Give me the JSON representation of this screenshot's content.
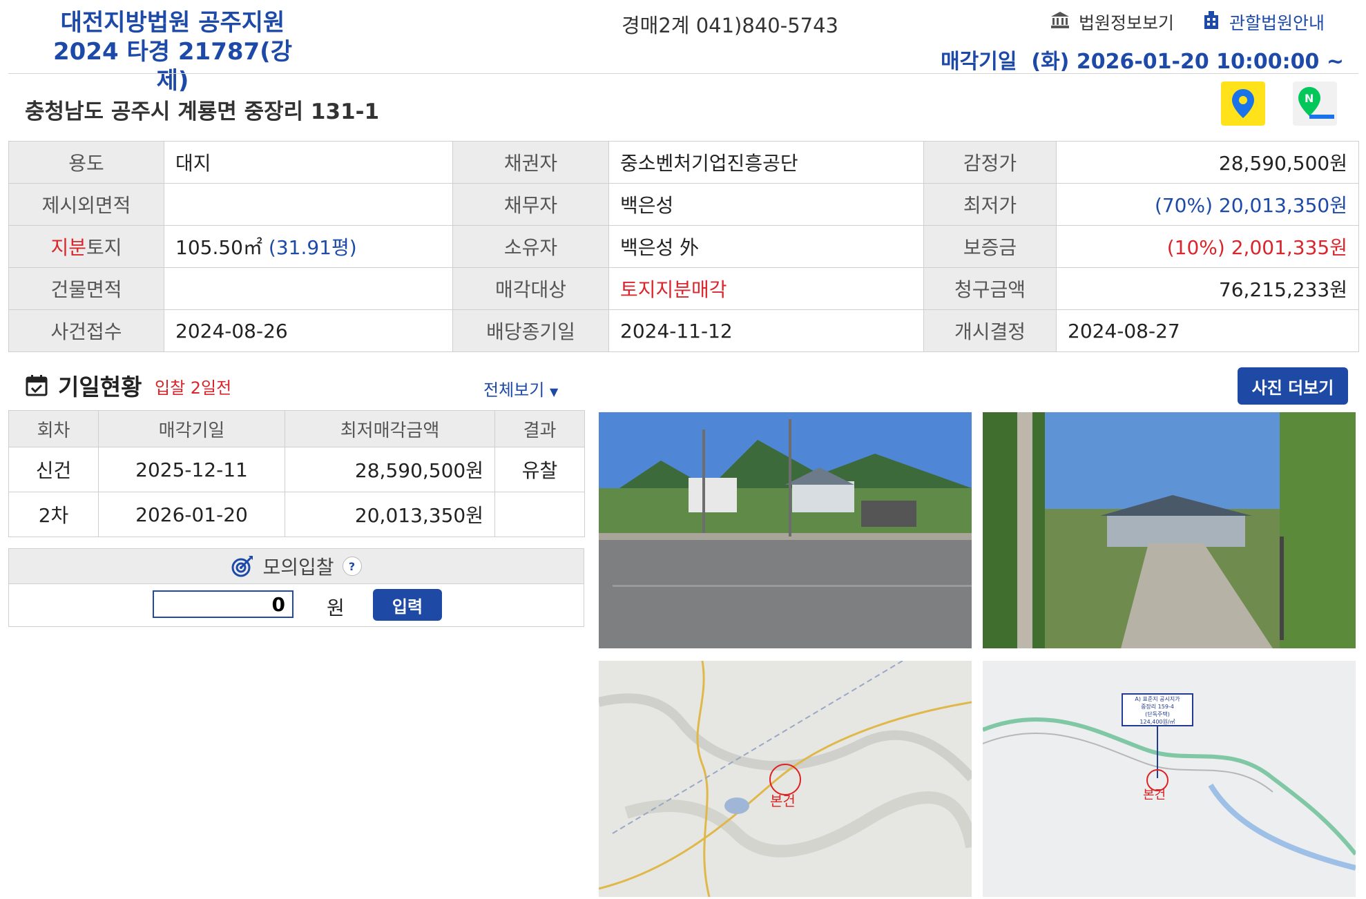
{
  "header": {
    "court_line1": "대전지방법원 공주지원",
    "court_line2": "2024 타경 21787(강제)",
    "department": "경매2계 041)840-5743",
    "court_info_link": "법원정보보기",
    "jurisdiction_link": "관할법원안내",
    "sale_date": "매각기일  (화) 2026-01-20 10:00:00 ~"
  },
  "address": "충청남도 공주시 계룡면 중장리 131-1",
  "info": {
    "usage_label": "용도",
    "usage": "대지",
    "creditor_label": "채권자",
    "creditor": "중소벤처기업진흥공단",
    "appraisal_label": "감정가",
    "appraisal": "28,590,500원",
    "extra_area_label": "제시외면적",
    "extra_area": "",
    "debtor_label": "채무자",
    "debtor": "백은성",
    "min_price_label": "최저가",
    "min_price": "(70%) 20,013,350원",
    "share_label_red": "지분",
    "share_label_rest": "토지",
    "share_area": "105.50㎡",
    "share_pyeong": "(31.91평)",
    "owner_label": "소유자",
    "owner": "백은성 外",
    "deposit_label": "보증금",
    "deposit": "(10%) 2,001,335원",
    "building_area_label": "건물면적",
    "building_area": "",
    "sale_target_label": "매각대상",
    "sale_target": "토지지분매각",
    "claim_label": "청구금액",
    "claim": "76,215,233원",
    "case_received_label": "사건접수",
    "case_received": "2024-08-26",
    "dividend_deadline_label": "배당종기일",
    "dividend_deadline": "2024-11-12",
    "start_decision_label": "개시결정",
    "start_decision": "2024-08-27"
  },
  "schedule": {
    "title": "기일현황",
    "subtitle": "입찰 2일전",
    "view_all": "전체보기",
    "photo_more": "사진 더보기",
    "headers": [
      "회차",
      "매각기일",
      "최저매각금액",
      "결과"
    ],
    "rows": [
      {
        "round": "신건",
        "date": "2025-12-11",
        "price": "28,590,500원",
        "result": "유찰"
      },
      {
        "round": "2차",
        "date": "2026-01-20",
        "price": "20,013,350원",
        "result": ""
      }
    ]
  },
  "mock_bid": {
    "title": "모의입찰",
    "help": "?",
    "value": "0",
    "unit": "원",
    "button": "입력"
  },
  "maps": {
    "label": "본건",
    "parcel_box": [
      "A) 표준지 공시지가",
      "중장리 159-4",
      "(단독주택)",
      "124,400원/㎡"
    ]
  },
  "colors": {
    "brand_blue": "#1d4aa8",
    "red": "#d9262c",
    "label_bg": "#ececec"
  }
}
